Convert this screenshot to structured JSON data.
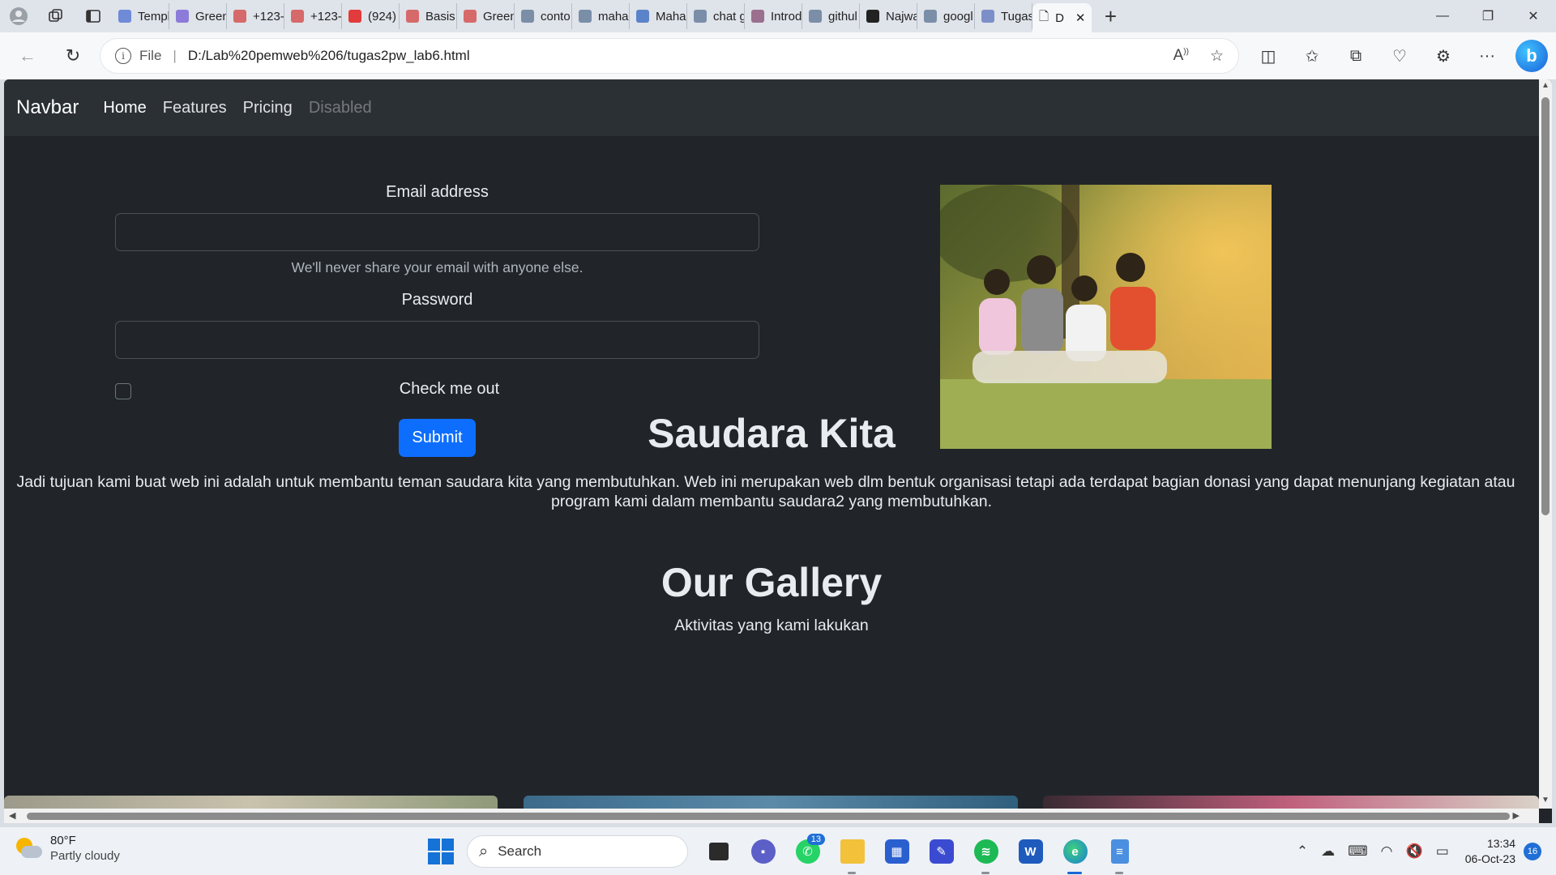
{
  "browser": {
    "tabs": [
      {
        "label": "Templ",
        "color": "#6f8bd8"
      },
      {
        "label": "Green",
        "color": "#8c7bd9"
      },
      {
        "label": "+123-",
        "color": "#d66a6a"
      },
      {
        "label": "+123-",
        "color": "#d66a6a"
      },
      {
        "label": "(924)",
        "color": "#e23b3b"
      },
      {
        "label": "Basis",
        "color": "#d66a6a"
      },
      {
        "label": "Green",
        "color": "#d66a6a"
      },
      {
        "label": "conto",
        "color": "#7a8ea8"
      },
      {
        "label": "maha",
        "color": "#7a8ea8"
      },
      {
        "label": "Maha",
        "color": "#5b83c9"
      },
      {
        "label": "chat g",
        "color": "#7a8ea8"
      },
      {
        "label": "Introd",
        "color": "#9b6f8e"
      },
      {
        "label": "githul",
        "color": "#7a8ea8"
      },
      {
        "label": "Najwa",
        "color": "#222222"
      },
      {
        "label": "googl",
        "color": "#7a8ea8"
      },
      {
        "label": "Tugas",
        "color": "#7d8fc9"
      }
    ],
    "active_tab": {
      "label": "D",
      "close": "✕"
    },
    "new_tab": "+",
    "address": {
      "scheme_label": "File",
      "url": "D:/Lab%20pemweb%206/tugas2pw_lab6.html"
    },
    "icons": [
      "back-icon",
      "refresh-icon",
      "read-aloud-icon",
      "favorite-star-icon",
      "split-screen-icon",
      "favorites-icon",
      "collections-icon",
      "browser-essentials-icon",
      "extensions-icon",
      "more-icon",
      "bing-icon"
    ]
  },
  "page": {
    "navbar": {
      "brand": "Navbar",
      "links": [
        {
          "label": "Home"
        },
        {
          "label": "Features"
        },
        {
          "label": "Pricing"
        },
        {
          "label": "Disabled"
        }
      ]
    },
    "form": {
      "email_label": "Email address",
      "email_value": "",
      "email_help": "We'll never share your email with anyone else.",
      "password_label": "Password",
      "password_value": "",
      "check_label": "Check me out",
      "submit_label": "Submit"
    },
    "about": {
      "title": "Saudara Kita",
      "line1": "Jadi tujuan kami buat web ini adalah untuk membantu teman saudara kita yang membutuhkan. Web ini merupakan web dlm bentuk organisasi tetapi ada terdapat bagian donasi yang dapat menunjang kegiatan atau",
      "line2": "program kami dalam membantu saudara2 yang membutuhkan."
    },
    "gallery": {
      "title": "Our Gallery",
      "subtitle": "Aktivitas yang kami lakukan"
    }
  },
  "taskbar": {
    "weather": {
      "temp": "80°F",
      "desc": "Partly cloudy"
    },
    "search_label": "Search",
    "whatsapp_badge": "13",
    "clock": {
      "time": "13:34",
      "date": "06-Oct-23"
    },
    "notifications": "16"
  }
}
